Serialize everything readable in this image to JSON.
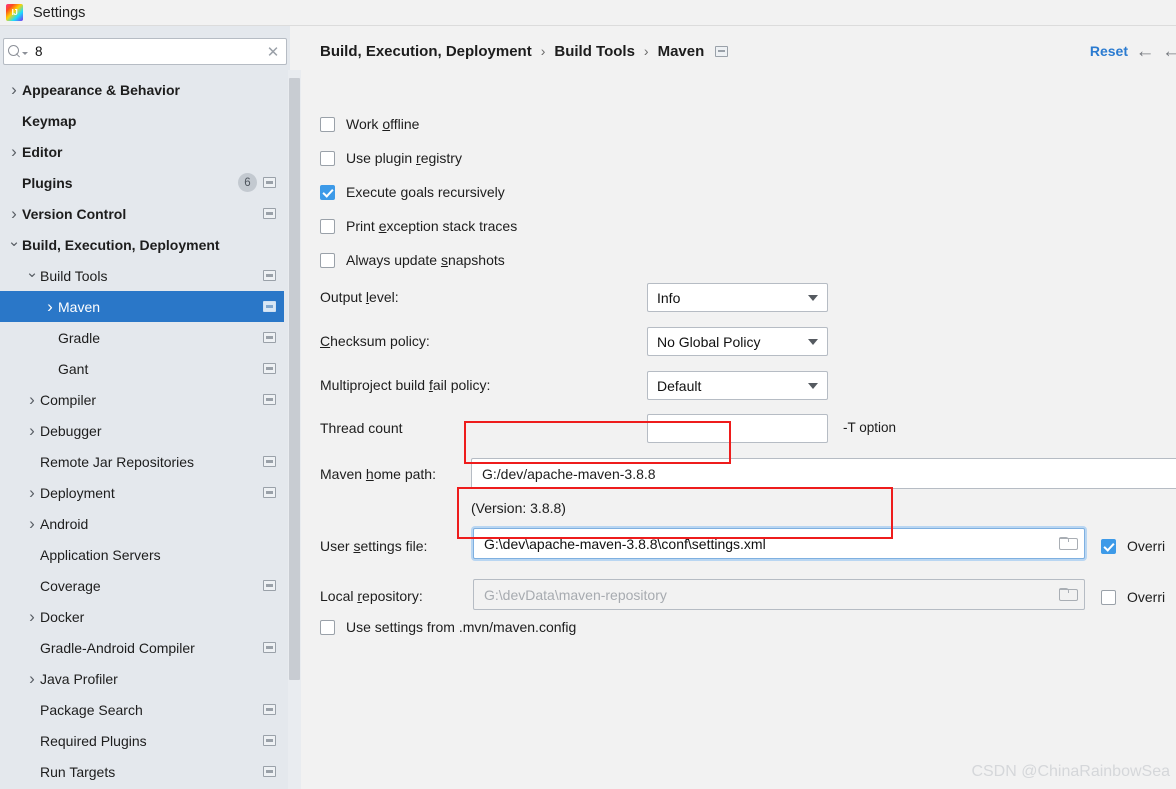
{
  "window": {
    "title": "Settings",
    "logo_icon": "intellij-idea-logo"
  },
  "sidebar": {
    "search": {
      "value": "8",
      "placeholder": "",
      "search_icon": "search-icon",
      "clear_icon": "clear-icon"
    },
    "items": [
      {
        "label": "Appearance & Behavior",
        "twisty": "right",
        "bold": true,
        "indent": 0,
        "scope_icon": false,
        "badge": null,
        "selected": false
      },
      {
        "label": "Keymap",
        "twisty": "none",
        "bold": true,
        "indent": 0,
        "scope_icon": false,
        "badge": null,
        "selected": false
      },
      {
        "label": "Editor",
        "twisty": "right",
        "bold": true,
        "indent": 0,
        "scope_icon": false,
        "badge": null,
        "selected": false
      },
      {
        "label": "Plugins",
        "twisty": "none",
        "bold": true,
        "indent": 0,
        "scope_icon": true,
        "badge": "6",
        "selected": false
      },
      {
        "label": "Version Control",
        "twisty": "right",
        "bold": true,
        "indent": 0,
        "scope_icon": true,
        "badge": null,
        "selected": false
      },
      {
        "label": "Build, Execution, Deployment",
        "twisty": "down",
        "bold": true,
        "indent": 0,
        "scope_icon": false,
        "badge": null,
        "selected": false
      },
      {
        "label": "Build Tools",
        "twisty": "down",
        "bold": false,
        "indent": 1,
        "scope_icon": true,
        "badge": null,
        "selected": false
      },
      {
        "label": "Maven",
        "twisty": "right",
        "bold": false,
        "indent": 2,
        "scope_icon": true,
        "badge": null,
        "selected": true
      },
      {
        "label": "Gradle",
        "twisty": "none",
        "bold": false,
        "indent": 2,
        "scope_icon": true,
        "badge": null,
        "selected": false
      },
      {
        "label": "Gant",
        "twisty": "none",
        "bold": false,
        "indent": 2,
        "scope_icon": true,
        "badge": null,
        "selected": false
      },
      {
        "label": "Compiler",
        "twisty": "right",
        "bold": false,
        "indent": 1,
        "scope_icon": true,
        "badge": null,
        "selected": false
      },
      {
        "label": "Debugger",
        "twisty": "right",
        "bold": false,
        "indent": 1,
        "scope_icon": false,
        "badge": null,
        "selected": false
      },
      {
        "label": "Remote Jar Repositories",
        "twisty": "none",
        "bold": false,
        "indent": 1,
        "scope_icon": true,
        "badge": null,
        "selected": false
      },
      {
        "label": "Deployment",
        "twisty": "right",
        "bold": false,
        "indent": 1,
        "scope_icon": true,
        "badge": null,
        "selected": false
      },
      {
        "label": "Android",
        "twisty": "right",
        "bold": false,
        "indent": 1,
        "scope_icon": false,
        "badge": null,
        "selected": false
      },
      {
        "label": "Application Servers",
        "twisty": "none",
        "bold": false,
        "indent": 1,
        "scope_icon": false,
        "badge": null,
        "selected": false
      },
      {
        "label": "Coverage",
        "twisty": "none",
        "bold": false,
        "indent": 1,
        "scope_icon": true,
        "badge": null,
        "selected": false
      },
      {
        "label": "Docker",
        "twisty": "right",
        "bold": false,
        "indent": 1,
        "scope_icon": false,
        "badge": null,
        "selected": false
      },
      {
        "label": "Gradle-Android Compiler",
        "twisty": "none",
        "bold": false,
        "indent": 1,
        "scope_icon": true,
        "badge": null,
        "selected": false
      },
      {
        "label": "Java Profiler",
        "twisty": "right",
        "bold": false,
        "indent": 1,
        "scope_icon": false,
        "badge": null,
        "selected": false
      },
      {
        "label": "Package Search",
        "twisty": "none",
        "bold": false,
        "indent": 1,
        "scope_icon": true,
        "badge": null,
        "selected": false
      },
      {
        "label": "Required Plugins",
        "twisty": "none",
        "bold": false,
        "indent": 1,
        "scope_icon": true,
        "badge": null,
        "selected": false
      },
      {
        "label": "Run Targets",
        "twisty": "none",
        "bold": false,
        "indent": 1,
        "scope_icon": true,
        "badge": null,
        "selected": false
      }
    ]
  },
  "header": {
    "breadcrumb": [
      "Build, Execution, Deployment",
      "Build Tools",
      "Maven"
    ],
    "separator": "›",
    "scope_icon": "project-scope-icon",
    "reset_label": "Reset",
    "back_icon": "arrow-left-icon",
    "forward_icon": "arrow-right-icon"
  },
  "main": {
    "checkboxes": [
      {
        "label_before": "Work ",
        "mnemonic": "o",
        "label_after": "ffline",
        "checked": false
      },
      {
        "label_before": "Use plugin ",
        "mnemonic": "r",
        "label_after": "egistry",
        "checked": false
      },
      {
        "label_before": "Execute ",
        "mnemonic": "g",
        "label_after": "oals recursively",
        "checked": true
      },
      {
        "label_before": "Print ",
        "mnemonic": "e",
        "label_after": "xception stack traces",
        "checked": false
      },
      {
        "label_before": "Always update ",
        "mnemonic": "s",
        "label_after": "napshots",
        "checked": false
      }
    ],
    "output_level": {
      "label_before": "Output ",
      "mnemonic": "l",
      "label_after": "evel:",
      "value": "Info"
    },
    "checksum_policy": {
      "label_before": "",
      "mnemonic": "C",
      "label_after": "hecksum policy:",
      "value": "No Global Policy"
    },
    "multiproject_policy": {
      "label_before": "Multiproject build ",
      "mnemonic": "f",
      "label_after": "ail policy:",
      "value": "Default"
    },
    "thread_count": {
      "label": "Thread count",
      "value": "",
      "hint": "-T option"
    },
    "maven_home": {
      "label_before": "Maven ",
      "mnemonic": "h",
      "label_after": "ome path:",
      "value": "G:/dev/apache-maven-3.8.8",
      "browse_label": "...",
      "version_note": "(Version: 3.8.8)"
    },
    "user_settings": {
      "label_before": "User ",
      "mnemonic": "s",
      "label_after": "ettings file:",
      "value": "G:\\dev\\apache-maven-3.8.8\\conf\\settings.xml",
      "folder_icon": "folder-icon",
      "override_label": "Overri",
      "override_checked": true
    },
    "local_repository": {
      "label_before": "Local ",
      "mnemonic": "r",
      "label_after": "epository:",
      "value": "G:\\devData\\maven-repository",
      "folder_icon": "folder-icon",
      "override_label": "Overri",
      "override_checked": false
    },
    "mvn_config": {
      "label": "Use settings from .mvn/maven.config",
      "checked": false
    }
  },
  "watermark": {
    "text": "CSDN @ChinaRainbowSea"
  },
  "colors": {
    "accent": "#2a77c8",
    "checkbox_checked": "#3d9ae8",
    "link": "#2b7bd0",
    "annotation_red": "#ee1c1c",
    "sidebar_bg": "#e4e8ed",
    "panel_bg": "#f2f2f2"
  }
}
